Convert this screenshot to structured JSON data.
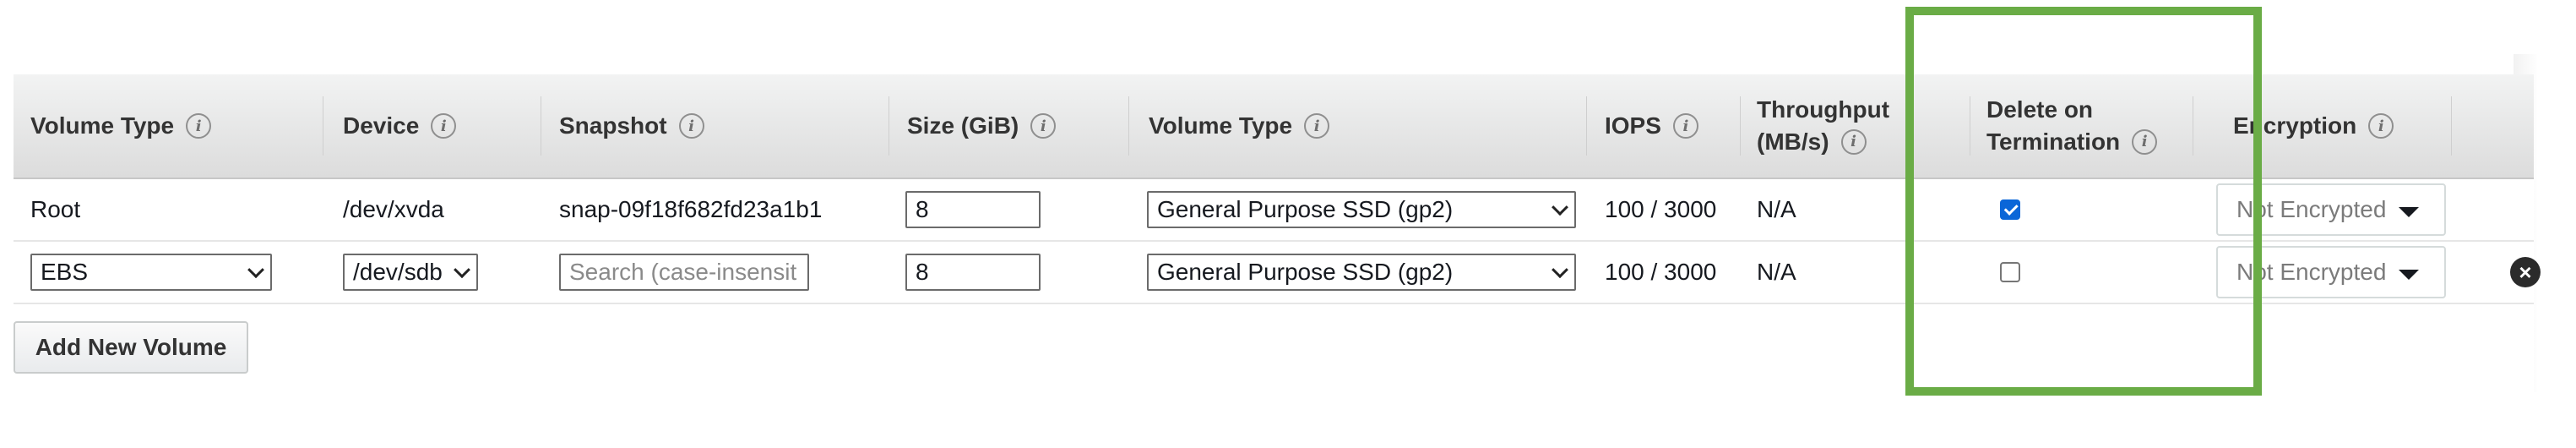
{
  "columns": {
    "volume_type": "Volume Type",
    "device": "Device",
    "snapshot": "Snapshot",
    "size": "Size (GiB)",
    "volume_type2": "Volume Type",
    "iops": "IOPS",
    "throughput_line1": "Throughput",
    "throughput_line2": "(MB/s)",
    "delete_line1": "Delete on",
    "delete_line2": "Termination",
    "encryption": "Encryption"
  },
  "rows": [
    {
      "volume_type": "Root",
      "device": "/dev/xvda",
      "snapshot": "snap-09f18f682fd23a1b1",
      "size": "8",
      "ebs_volume_type": "General Purpose SSD (gp2)",
      "iops": "100 / 3000",
      "throughput": "N/A",
      "delete_on_termination": true,
      "encryption": "Not Encrypted"
    },
    {
      "volume_type": "EBS",
      "device": "/dev/sdb",
      "snapshot_placeholder": "Search (case-insensit",
      "size": "8",
      "ebs_volume_type": "General Purpose SSD (gp2)",
      "iops": "100 / 3000",
      "throughput": "N/A",
      "delete_on_termination": false,
      "encryption": "Not Encrypted"
    }
  ],
  "actions": {
    "add_new_volume": "Add New Volume"
  },
  "icons": {
    "info": "info-icon",
    "remove": "remove-icon"
  },
  "colors": {
    "highlight": "#6aac46",
    "checkbox_checked": "#0a66d8"
  }
}
